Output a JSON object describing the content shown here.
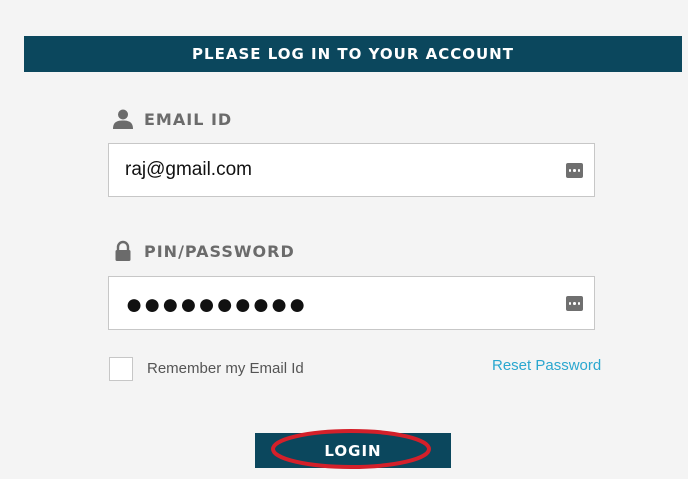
{
  "header": {
    "title": "PLEASE LOG IN TO YOUR ACCOUNT"
  },
  "email_field": {
    "label": "EMAIL ID",
    "value": "raj@gmail.com",
    "label_icon": "user-icon",
    "widget_icon": "password-manager-icon"
  },
  "password_field": {
    "label": "PIN/PASSWORD",
    "masked_value": "●●●●●●●●●●",
    "label_icon": "lock-icon",
    "widget_icon": "password-manager-icon"
  },
  "remember": {
    "label": "Remember my Email Id",
    "checked": false
  },
  "reset_link": {
    "label": "Reset Password"
  },
  "login_button": {
    "label": "LOGIN"
  },
  "colors": {
    "brand": "#0b475d",
    "link": "#2aa7cf",
    "annotation": "#d4202a",
    "background": "#f4f4f4"
  }
}
